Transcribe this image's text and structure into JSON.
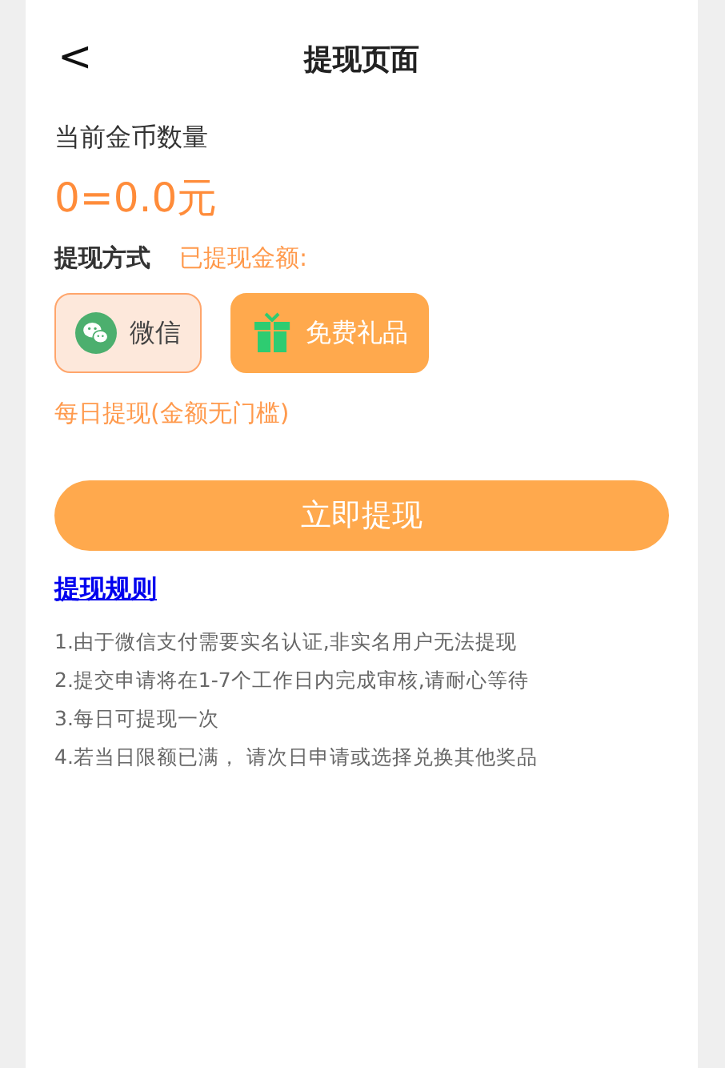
{
  "header": {
    "back": "<",
    "title": "提现页面"
  },
  "coins": {
    "label": "当前金币数量",
    "value": "0=0.0元"
  },
  "method": {
    "label": "提现方式",
    "withdrawn_label": "已提现金额:"
  },
  "options": [
    {
      "kind": "wechat",
      "label": "微信",
      "selected": true
    },
    {
      "kind": "gift",
      "label": "免费礼品",
      "selected": false
    }
  ],
  "daily_note": "每日提现(金额无门槛)",
  "submit": "立即提现",
  "rules_link": "提现规则",
  "rules": [
    "1.由于微信支付需要实名认证,非实名用户无法提现",
    "2.提交申请将在1-7个工作日内完成审核,请耐心等待",
    "3.每日可提现一次",
    "4.若当日限额已满， 请次日申请或选择兑换其他奖品"
  ]
}
